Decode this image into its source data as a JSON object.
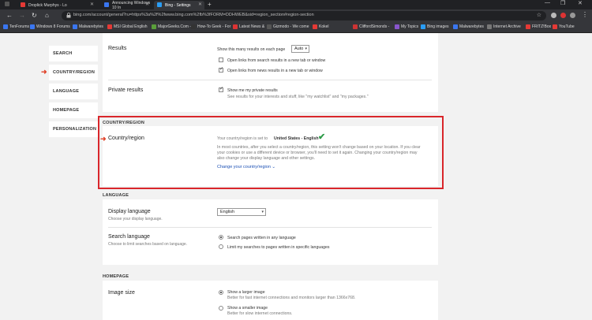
{
  "browser": {
    "tabs": [
      {
        "title": "Droplick Murphys - Lo",
        "active": false,
        "icon_color": "#e53935"
      },
      {
        "title": "Announcing Windows 10 In",
        "active": false,
        "icon_color": "#3a76f0"
      },
      {
        "title": "Bing - Settings",
        "active": true,
        "icon_color": "#2a9df4"
      }
    ],
    "new_tab": "+",
    "window_controls": [
      "—",
      "❐",
      "✕"
    ],
    "url": "bing.com/account/general?ru=https%3a%2f%2fwww.bing.com%2fb%3fFORM=DDHWEB&sid=region_section#region-section",
    "bookmarks": [
      {
        "label": "TenForums",
        "color": "#3a76f0"
      },
      {
        "label": "Windows 8 Forums",
        "color": "#3a76f0"
      },
      {
        "label": "Malwarebytes",
        "color": "#3a76f0"
      },
      {
        "label": "MSI Global English",
        "color": "#e53935"
      },
      {
        "label": "MajorGeeks.Com -",
        "color": "#5a9e3a"
      },
      {
        "label": "How-To Geek - For",
        "color": "#333"
      },
      {
        "label": "Latest News &",
        "color": "#d33"
      },
      {
        "label": "Gizmodo - We come",
        "color": "#555"
      },
      {
        "label": "Kokel",
        "color": "#e53935"
      },
      {
        "label": "CliffordSimonds -",
        "color": "#c33"
      },
      {
        "label": "My Topics",
        "color": "#8855cc"
      },
      {
        "label": "Bing images",
        "color": "#2a9df4"
      },
      {
        "label": "Malwarebytes",
        "color": "#3a76f0"
      },
      {
        "label": "Internet Archive",
        "color": "#777"
      },
      {
        "label": "FRITZ!Box",
        "color": "#e53935"
      },
      {
        "label": "YouTube",
        "color": "#e53935"
      }
    ]
  },
  "sidebar": {
    "items": [
      {
        "label": "SEARCH"
      },
      {
        "label": "COUNTRY/REGION"
      },
      {
        "label": "LANGUAGE"
      },
      {
        "label": "HOMEPAGE"
      },
      {
        "label": "PERSONALIZATION"
      }
    ]
  },
  "results": {
    "label": "Results",
    "per_page_text": "Show this many results on each page",
    "per_page_value": "Auto",
    "opt1": "Open links from search results in a new tab or window",
    "opt1_checked": false,
    "opt2": "Open links from news results in a new tab or window",
    "opt2_checked": true
  },
  "private": {
    "label": "Private results",
    "opt": "Show me my private results",
    "opt_checked": true,
    "desc": "See results for your interests and stuff, like \"my watchlist\" and \"my packages.\""
  },
  "country": {
    "section": "COUNTRY/REGION",
    "label": "Country/region",
    "set_prefix": "Your country/region is set to",
    "set_value": "United States - English",
    "desc": [
      "In most countries, after you select a country/region, this setting won't change based on your location. If you clear",
      "your cookies or use a different device or browser, you'll need to set it again. Changing your country/region may",
      "also change your display language and other settings."
    ],
    "change_link": "Change your country/region"
  },
  "language": {
    "section": "LANGUAGE",
    "display_label": "Display language",
    "display_sub": "Choose your display language.",
    "display_value": "English",
    "search_label": "Search language",
    "search_sub": "Choose to limit searches based on language.",
    "opt1": "Search pages written in any language",
    "opt2": "Limit my searches to pages written in specific languages"
  },
  "homepage": {
    "section": "HOMEPAGE",
    "label": "Image size",
    "opt1": "Show a larger image",
    "opt1_desc": "Better for fast internet connections and monitors larger than 1366x768.",
    "opt2": "Show a smaller image",
    "opt2_desc": "Better for slow internet connections."
  }
}
